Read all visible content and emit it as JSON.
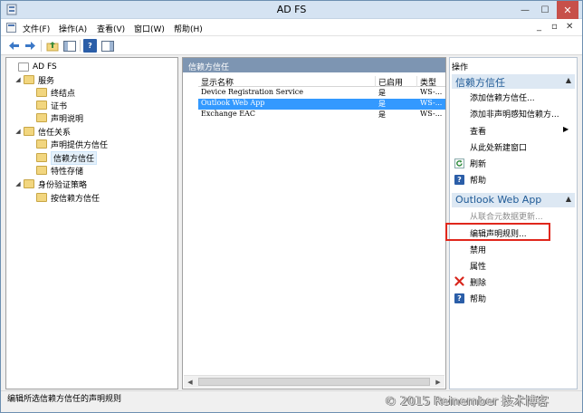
{
  "window": {
    "title": "AD FS",
    "minimize_glyph": "—",
    "maximize_glyph": "☐",
    "close_glyph": "✕"
  },
  "menubar": {
    "items": [
      "文件(F)",
      "操作(A)",
      "查看(V)",
      "窗口(W)",
      "帮助(H)"
    ],
    "right_controls": [
      "_",
      "▫",
      "✕"
    ]
  },
  "tree": {
    "items": [
      {
        "label": "AD FS",
        "level": 0,
        "twisty": ""
      },
      {
        "label": "服务",
        "level": 1,
        "twisty": "◢"
      },
      {
        "label": "终结点",
        "level": 2,
        "twisty": ""
      },
      {
        "label": "证书",
        "level": 2,
        "twisty": ""
      },
      {
        "label": "声明说明",
        "level": 2,
        "twisty": ""
      },
      {
        "label": "信任关系",
        "level": 1,
        "twisty": "◢"
      },
      {
        "label": "声明提供方信任",
        "level": 2,
        "twisty": ""
      },
      {
        "label": "信赖方信任",
        "level": 2,
        "twisty": "",
        "selected": true
      },
      {
        "label": "特性存储",
        "level": 2,
        "twisty": ""
      },
      {
        "label": "身份验证策略",
        "level": 1,
        "twisty": "◢"
      },
      {
        "label": "按信赖方信任",
        "level": 2,
        "twisty": ""
      }
    ]
  },
  "center": {
    "title": "信赖方信任",
    "columns": [
      "显示名称",
      "已启用",
      "类型"
    ],
    "rows": [
      {
        "name": "Device Registration Service",
        "enabled": "是",
        "type": "WS-..."
      },
      {
        "name": "Outlook Web App",
        "enabled": "是",
        "type": "WS-...",
        "selected": true
      },
      {
        "name": "Exchange EAC",
        "enabled": "是",
        "type": "WS-..."
      }
    ],
    "scroll_left": "◀",
    "scroll_right": "▶"
  },
  "actions": {
    "title": "操作",
    "section1": {
      "title": "信赖方信任",
      "items": [
        {
          "label": "添加信赖方信任...",
          "icon": ""
        },
        {
          "label": "添加非声明感知信赖方...",
          "icon": ""
        },
        {
          "label": "查看",
          "icon": "",
          "submenu": "▶"
        },
        {
          "label": "从此处新建窗口",
          "icon": ""
        },
        {
          "label": "刷新",
          "icon": "refresh-icon"
        },
        {
          "label": "帮助",
          "icon": "help-icon"
        }
      ]
    },
    "section2": {
      "title": "Outlook Web App",
      "items": [
        {
          "label": "从联合元数据更新...",
          "icon": "",
          "disabled": true
        },
        {
          "label": "编辑声明规则...",
          "icon": "",
          "highlighted": true
        },
        {
          "label": "禁用",
          "icon": ""
        },
        {
          "label": "属性",
          "icon": ""
        },
        {
          "label": "删除",
          "icon": "delete-icon"
        },
        {
          "label": "帮助",
          "icon": "help-icon"
        }
      ]
    },
    "collapse_glyph": "▲",
    "help_glyph": "?"
  },
  "statusbar": {
    "text": "编辑所选信赖方信任的声明规则"
  },
  "watermark": {
    "text": "© 2015 Reinember 技术博客"
  },
  "colors": {
    "pane_header": "#7d95b2",
    "selection": "#3399ff",
    "action_heading": "#1f5a96",
    "highlight_box": "#e0271c"
  }
}
